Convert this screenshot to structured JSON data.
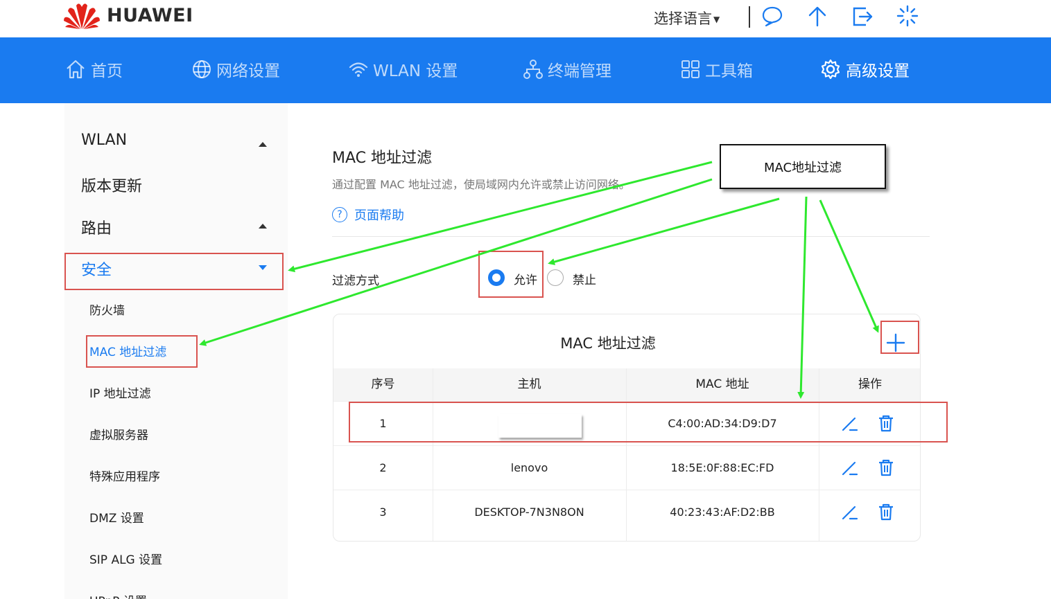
{
  "brand": {
    "name": "HUAWEI",
    "color": "#e2231a"
  },
  "header": {
    "language_label": "选择语言",
    "icons": [
      "chat-icon",
      "upload-icon",
      "logout-icon",
      "loading-icon"
    ]
  },
  "nav": {
    "items": [
      {
        "label": "首页",
        "icon": "home-icon"
      },
      {
        "label": "网络设置",
        "icon": "globe-icon"
      },
      {
        "label": "WLAN 设置",
        "icon": "wifi-icon"
      },
      {
        "label": "终端管理",
        "icon": "devices-icon"
      },
      {
        "label": "工具箱",
        "icon": "grid-icon"
      },
      {
        "label": "高级设置",
        "icon": "gear-icon",
        "active": true
      }
    ],
    "color": "#1a7bf0"
  },
  "sidebar": {
    "sections": [
      {
        "label": "WLAN"
      },
      {
        "label": "版本更新"
      },
      {
        "label": "路由"
      },
      {
        "label": "安全",
        "active": true
      }
    ],
    "sub_items": [
      {
        "label": "防火墙"
      },
      {
        "label": "MAC 地址过滤",
        "active": true
      },
      {
        "label": "IP 地址过滤"
      },
      {
        "label": "虚拟服务器"
      },
      {
        "label": "特殊应用程序"
      },
      {
        "label": "DMZ 设置"
      },
      {
        "label": "SIP ALG 设置"
      },
      {
        "label": "UPnP 设置"
      }
    ]
  },
  "main": {
    "title": "MAC 地址过滤",
    "description": "通过配置 MAC 地址过滤，使局域网内允许或禁止访问网络。",
    "help_label": "页面帮助",
    "filter": {
      "label": "过滤方式",
      "options": [
        {
          "label": "允许",
          "selected": true
        },
        {
          "label": "禁止",
          "selected": false
        }
      ]
    },
    "table": {
      "title": "MAC 地址过滤",
      "columns": [
        "序号",
        "主机",
        "MAC 地址",
        "操作"
      ],
      "rows": [
        {
          "index": "1",
          "host": "",
          "mac": "C4:00:AD:34:D9:D7"
        },
        {
          "index": "2",
          "host": "lenovo",
          "mac": "18:5E:0F:88:EC:FD"
        },
        {
          "index": "3",
          "host": "DESKTOP-7N3N8ON",
          "mac": "40:23:43:AF:D2:BB"
        }
      ]
    }
  },
  "annotation": {
    "callout_text": "MAC地址过滤",
    "arrow_color": "#2ee82e",
    "box_color": "#d9534f"
  }
}
